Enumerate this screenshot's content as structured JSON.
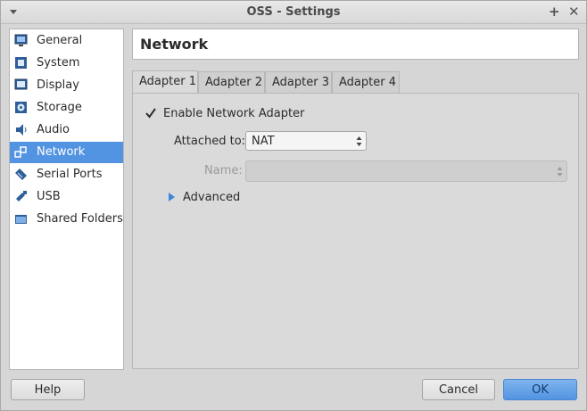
{
  "window": {
    "title": "OSS - Settings"
  },
  "sidebar": {
    "items": [
      {
        "label": "General",
        "icon": "monitor-icon"
      },
      {
        "label": "System",
        "icon": "chip-icon"
      },
      {
        "label": "Display",
        "icon": "display-icon"
      },
      {
        "label": "Storage",
        "icon": "storage-icon"
      },
      {
        "label": "Audio",
        "icon": "speaker-icon"
      },
      {
        "label": "Network",
        "icon": "network-icon",
        "selected": true
      },
      {
        "label": "Serial Ports",
        "icon": "serial-icon"
      },
      {
        "label": "USB",
        "icon": "usb-icon"
      },
      {
        "label": "Shared Folders",
        "icon": "folder-icon"
      }
    ]
  },
  "header": {
    "title": "Network"
  },
  "tabs": [
    {
      "label": "Adapter 1",
      "active": true
    },
    {
      "label": "Adapter 2"
    },
    {
      "label": "Adapter 3"
    },
    {
      "label": "Adapter 4"
    }
  ],
  "form": {
    "enable_label": "Enable Network Adapter",
    "enable_checked": true,
    "attached_label": "Attached to:",
    "attached_value": "NAT",
    "name_label": "Name:",
    "name_value": "",
    "advanced_label": "Advanced"
  },
  "buttons": {
    "help": "Help",
    "cancel": "Cancel",
    "ok": "OK"
  },
  "colors": {
    "selection": "#5294e2",
    "ok_button": "#6aa6ea",
    "expander": "#3f86d8"
  }
}
